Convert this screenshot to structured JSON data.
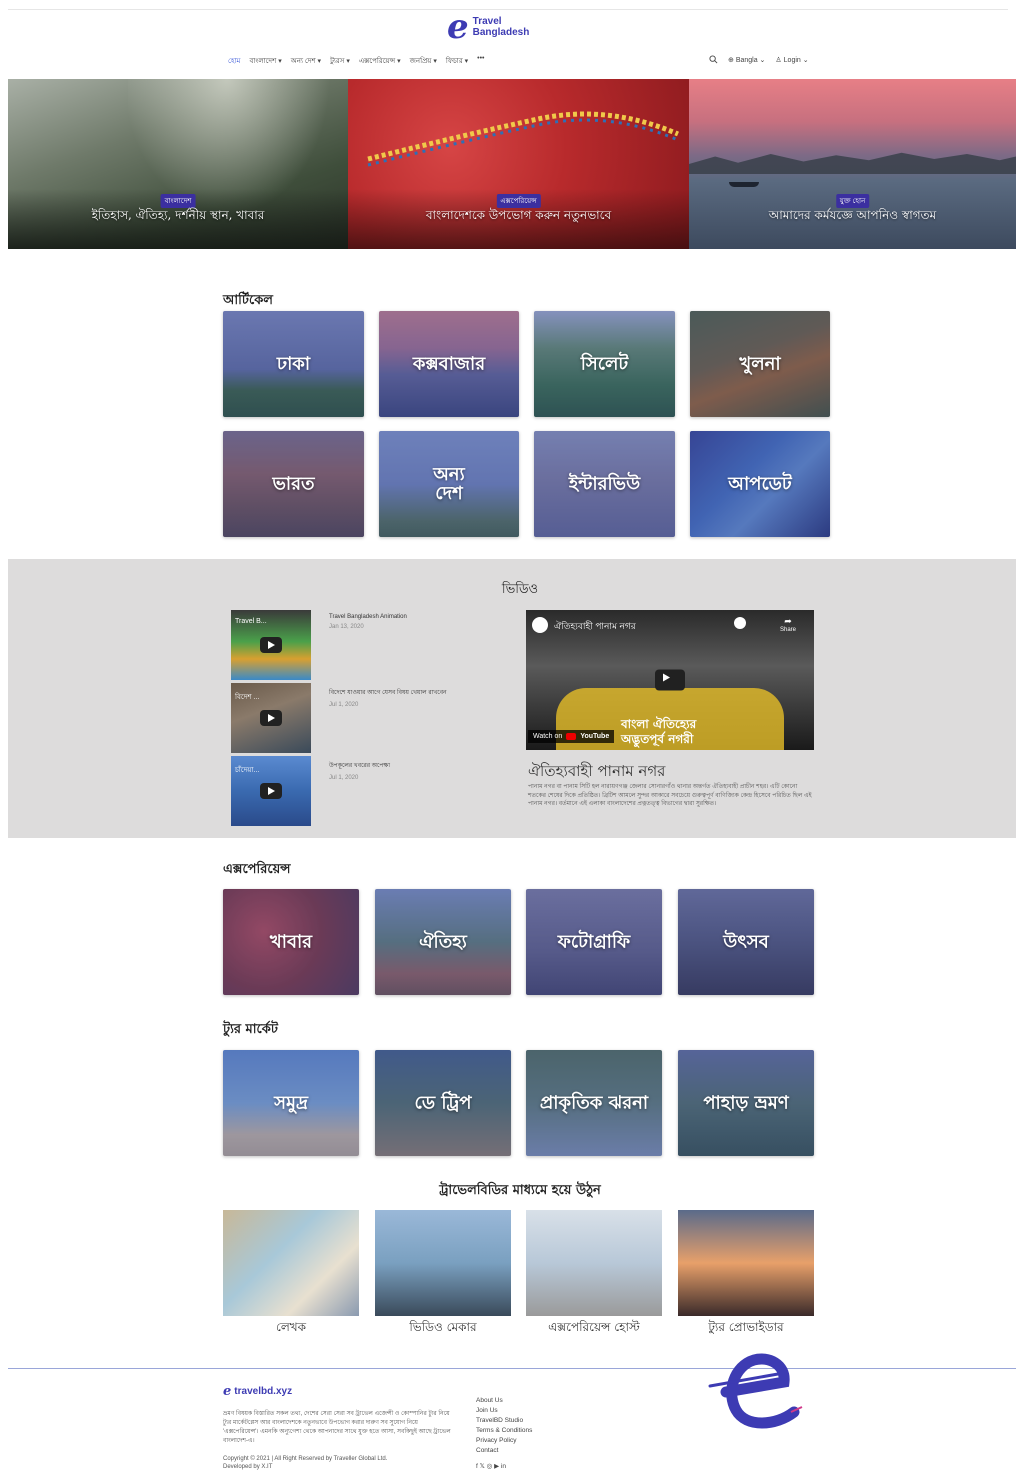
{
  "brand": {
    "mark": "e",
    "line1": "Travel",
    "line2": "Bangladesh",
    "color": "#3d3bb3"
  },
  "nav": {
    "items": [
      "হোম",
      "বাংলাদেশ ▾",
      "অন্য দেশ ▾",
      "ট্যুরস ▾",
      "এক্সপেরিয়েন্স ▾",
      "জনপ্রিয় ▾",
      "ফিচার ▾",
      "•••"
    ],
    "language": "Bangla",
    "login": "Login"
  },
  "hero": [
    {
      "badge": "বাংলাদেশ",
      "title": "ইতিহাস, ঐতিহ্য, দর্শনীয় স্থান, খাবার"
    },
    {
      "badge": "এক্সপেরিয়েন্স",
      "title": "বাংলাদেশকে উপভোগ করুন নতুনভাবে"
    },
    {
      "badge": "যুক্ত হোন",
      "title": "আমাদের কর্মযজ্ঞে আপনিও স্বাগতম"
    }
  ],
  "articles": {
    "title": "আর্টিকেল",
    "tiles": [
      "ঢাকা",
      "কক্সবাজার",
      "সিলেট",
      "খুলনা",
      "ভারত",
      "অন্য দেশ",
      "ইন্টারভিউ",
      "আপডেট"
    ]
  },
  "video": {
    "title": "ভিডিও",
    "list": [
      {
        "thumb": "Travel B...",
        "title": "Travel Bangladesh Animation",
        "date": "Jan 13, 2020"
      },
      {
        "thumb": "বিদেশ ...",
        "title": "বিদেশে যাওয়ার আগে যেসব বিষয় খেয়াল রাখবেন",
        "date": "Jul 1, 2020"
      },
      {
        "thumb": "চাঁদেয়া...",
        "title": "উপকূলের খবরের অপেক্ষা",
        "date": "Jul 1, 2020"
      }
    ],
    "player": {
      "channel_title": "ঐতিহ্যবাহী পানাম নগর",
      "overlay1": "বাংলা ঐতিহ্যের",
      "overlay2": "অদ্ভুতপূর্ব নগরী",
      "watch_on": "Watch on",
      "youtube": "YouTube",
      "share": "Share"
    },
    "feature_title": "ঐতিহ্যবাহী পানাম নগর",
    "feature_text": "পানাম নগর বা পানাম সিটি হল নারায়ণগঞ্জ জেলার সোনারগাঁও থানার অন্তর্গত ঐতিহ্যবাহী প্রাচীন শহর। এটি কোনো শতকের শেষের দিকে প্রতিষ্ঠিত। ব্রিটিশ আমলে সুন্দর আকারে সবচেয়ে গুরুত্বপূর্ণ বাণিজ্যিক কেন্দ্র হিসেবে পরিচিত ছিল এই পানাম নগর। বর্তমানে এই এলাকা বাংলাদেশের প্রত্নতত্ত্ব বিভাগের দ্বারা সুরক্ষিত।"
  },
  "experience": {
    "title": "এক্সপেরিয়েন্স",
    "tiles": [
      "খাবার",
      "ঐতিহ্য",
      "ফটোগ্রাফি",
      "উৎসব"
    ]
  },
  "tour_market": {
    "title": "ট্যুর মার্কেট",
    "tiles": [
      "সমুদ্র",
      "ডে ট্রিপ",
      "প্রাকৃতিক ঝরনা",
      "পাহাড় ভ্রমণ"
    ]
  },
  "join": {
    "title": "ট্রাভেলবিডির মাধ্যমে হয়ে উঠুন",
    "items": [
      "লেখক",
      "ভিডিও মেকার",
      "এক্সপেরিয়েন্স হোস্ট",
      "ট্যুর প্রোভাইডার"
    ]
  },
  "footer": {
    "logo": "travelbd.xyz",
    "about": "ভ্রমণ বিষয়ক বিস্তারিত সকল তথ্য, দেশের সেরা সেরা সব ট্রাভেল এজেন্সী ও কোম্পানির ট্যুর নিয়ে ট্যুর মার্কেটপ্লেস আর বাংলাদেশকে নতুনভাবে উপভোগ করার দারুণ সব সুযোগ নিয়ে 'এক্সপেরিয়েন্স'। এমনকি অন্যুগেশ্য থেকে আপনাদের সাথে যুক্ত হতে আসা, সবকিছুই আছে ট্রাভেল বাংলাদেশ-এ।",
    "copyright": "Copyright © 2021 | All Right Reserved by Traveller Global Ltd.",
    "developed": "Developed by X.IT",
    "links": [
      "About Us",
      "Join Us",
      "TravelBD Studio",
      "Terms & Conditions",
      "Privacy Policy",
      "Contact"
    ],
    "social": "f  𝕏  ◎  ▶  in"
  }
}
